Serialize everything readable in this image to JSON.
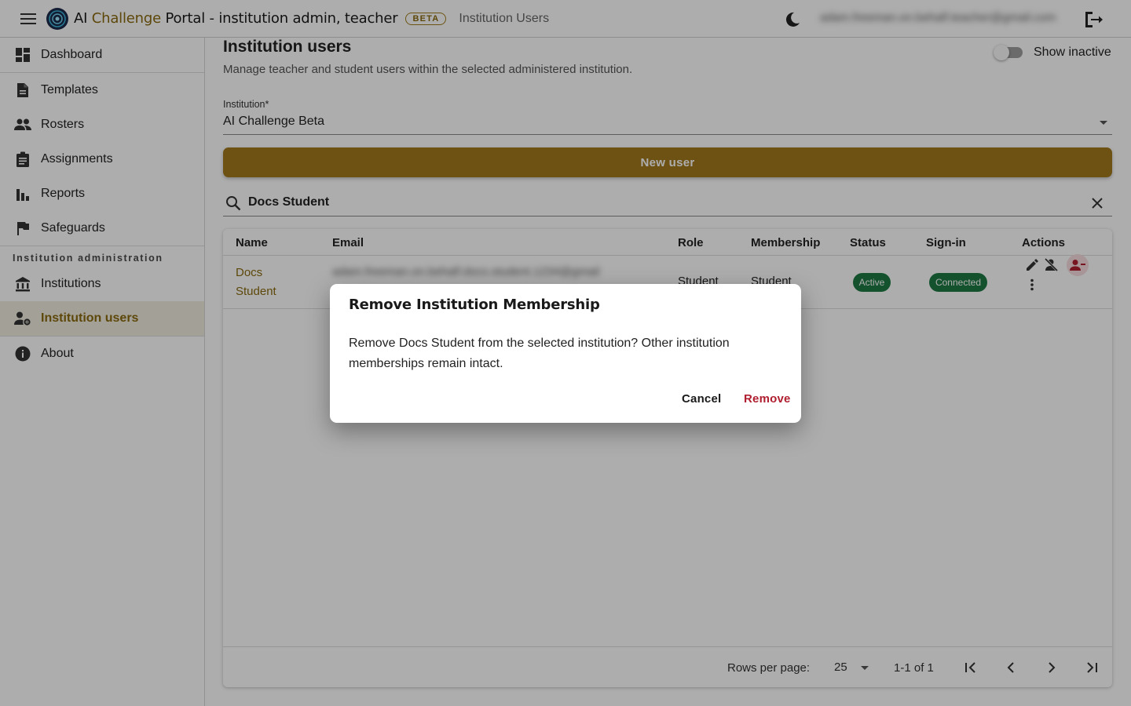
{
  "header": {
    "title_prefix": "AI ",
    "title_accent": "Challenge",
    "title_rest": " Portal - institution admin, teacher",
    "badge": "BETA",
    "page_name": "Institution Users",
    "user_email": "adam.freeman.on.behalf.teacher@gmail.com"
  },
  "sidebar": {
    "items": [
      {
        "label": "Dashboard",
        "icon": "dashboard-icon"
      },
      {
        "label": "Templates",
        "icon": "document-icon"
      },
      {
        "label": "Rosters",
        "icon": "people-icon"
      },
      {
        "label": "Assignments",
        "icon": "clipboard-icon"
      },
      {
        "label": "Reports",
        "icon": "bar-chart-icon"
      },
      {
        "label": "Safeguards",
        "icon": "flag-icon"
      }
    ],
    "section_title": "Institution administration",
    "admin_items": [
      {
        "label": "Institutions",
        "icon": "bank-icon"
      },
      {
        "label": "Institution users",
        "icon": "manage-accounts-icon",
        "active": true
      }
    ],
    "bottom_items": [
      {
        "label": "About",
        "icon": "info-icon"
      }
    ]
  },
  "main": {
    "title": "Institution users",
    "subtitle": "Manage teacher and student users within the selected administered institution.",
    "show_inactive_label": "Show inactive",
    "show_inactive": false,
    "institution_label": "Institution*",
    "institution_value": "AI Challenge Beta",
    "new_user_label": "New user",
    "search_value": "Docs Student",
    "table": {
      "columns": [
        "Name",
        "Email",
        "Role",
        "Membership",
        "Status",
        "Sign-in",
        "Actions"
      ],
      "rows": [
        {
          "name_line1": "Docs",
          "name_line2": "Student",
          "email": "adam.freeman.on.behalf.docs.student.1234@gmail",
          "role": "Student",
          "membership": "Student",
          "status": "Active",
          "signin": "Connected"
        }
      ]
    },
    "footer": {
      "rows_per_page_label": "Rows per page:",
      "rows_per_page": "25",
      "range": "1-1 of 1"
    }
  },
  "dialog": {
    "title": "Remove Institution Membership",
    "body": "Remove Docs Student from the selected institution? Other institution memberships remain intact.",
    "cancel_label": "Cancel",
    "remove_label": "Remove"
  },
  "colors": {
    "accent": "#a27a1e",
    "status_green": "#1e7a45",
    "danger": "#b01f30"
  }
}
